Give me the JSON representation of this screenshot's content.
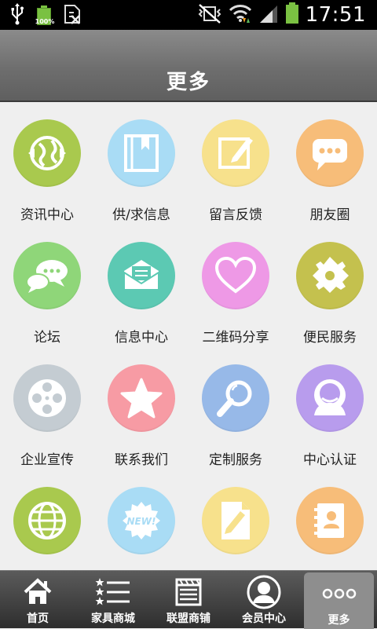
{
  "status_bar": {
    "battery_small_label": "100%",
    "time": "17:51"
  },
  "header": {
    "title": "更多"
  },
  "grid": {
    "items": [
      {
        "label": "资讯中心",
        "icon": "globe-arrows-icon",
        "color": "#a9c94e"
      },
      {
        "label": "供/求信息",
        "icon": "book-icon",
        "color": "#a9dcf5"
      },
      {
        "label": "留言反馈",
        "icon": "note-pencil-icon",
        "color": "#f7e18c"
      },
      {
        "label": "朋友圈",
        "icon": "chat-bubble-icon",
        "color": "#f7bd79"
      },
      {
        "label": "论坛",
        "icon": "chat-bubbles-icon",
        "color": "#8fd679"
      },
      {
        "label": "信息中心",
        "icon": "envelope-icon",
        "color": "#5cc9b3"
      },
      {
        "label": "二维码分享",
        "icon": "heart-icon",
        "color": "#ee99e6"
      },
      {
        "label": "便民服务",
        "icon": "puzzle-icon",
        "color": "#c4c14e"
      },
      {
        "label": "企业宣传",
        "icon": "film-reel-icon",
        "color": "#c4ccd2"
      },
      {
        "label": "联系我们",
        "icon": "star-icon",
        "color": "#f79ba4"
      },
      {
        "label": "定制服务",
        "icon": "magnifier-icon",
        "color": "#97b9e8"
      },
      {
        "label": "中心认证",
        "icon": "user-icon",
        "color": "#b89ced"
      },
      {
        "label": "",
        "icon": "globe-grid-icon",
        "color": "#a9c94e"
      },
      {
        "label": "",
        "icon": "new-badge-icon",
        "color": "#a9dcf5"
      },
      {
        "label": "",
        "icon": "document-pencil-icon",
        "color": "#f7e18c"
      },
      {
        "label": "",
        "icon": "contact-book-icon",
        "color": "#f7bd79"
      }
    ]
  },
  "tabbar": {
    "tabs": [
      {
        "label": "首页",
        "icon": "home-icon"
      },
      {
        "label": "家具商城",
        "icon": "star-list-icon"
      },
      {
        "label": "联盟商铺",
        "icon": "storefront-icon"
      },
      {
        "label": "会员中心",
        "icon": "member-avatar-icon"
      },
      {
        "label": "更多",
        "icon": "more-dots-icon",
        "active": true
      }
    ]
  }
}
